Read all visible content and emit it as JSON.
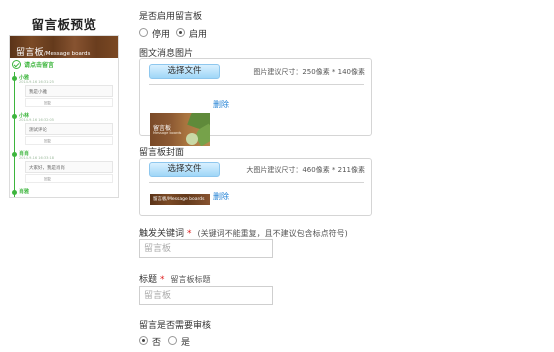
{
  "preview": {
    "title": "留言板预览",
    "phone": {
      "header_title": "留言板",
      "header_subtitle": "/Message boards",
      "cta_label": "请点击留言",
      "messages": [
        {
          "name": "小雅",
          "time": "2014-9-16 16:31:25",
          "content": "我是小雅",
          "reply": "回复"
        },
        {
          "name": "小林",
          "time": "2014-9-16 16:32:05",
          "content": "测试评论",
          "reply": "回复"
        },
        {
          "name": "肖肖",
          "time": "2014-9-16 16:33:18",
          "content": "大家好，我是肖肖",
          "reply": "回复"
        },
        {
          "name": "肖雅",
          "time": "",
          "content": "",
          "reply": ""
        }
      ]
    }
  },
  "form": {
    "enable": {
      "label": "是否启用留言板",
      "options": [
        {
          "label": "停用",
          "checked": false
        },
        {
          "label": "启用",
          "checked": true
        }
      ]
    },
    "image_message": {
      "label": "图文消息图片",
      "button": "选择文件",
      "size_hint": "图片建议尺寸：250像素 * 140像素",
      "thumb_text": "留言板",
      "thumb_subtext": "Message boards",
      "delete": "删除"
    },
    "cover": {
      "label": "留言板封面",
      "button": "选择文件",
      "size_hint": "大图片建议尺寸：460像素 * 211像素",
      "thumb_text": "留言板/Message boards",
      "delete": "删除"
    },
    "keyword": {
      "label": "触发关键词",
      "required_mark": "*",
      "hint": "(关键词不能重复，且不建议包含标点符号)",
      "value": "",
      "placeholder": "留言板"
    },
    "title": {
      "label": "标题",
      "required_mark": "*",
      "hint": "留言板标题",
      "value": "",
      "placeholder": "留言板"
    },
    "review": {
      "label": "留言是否需要审核",
      "options": [
        {
          "label": "否",
          "checked": true
        },
        {
          "label": "是",
          "checked": false
        }
      ]
    }
  },
  "colors": {
    "accent_green": "#3db53d",
    "link_blue": "#1e7fd4",
    "required_red": "#e02020",
    "header_wood": "#6b3f1f"
  }
}
